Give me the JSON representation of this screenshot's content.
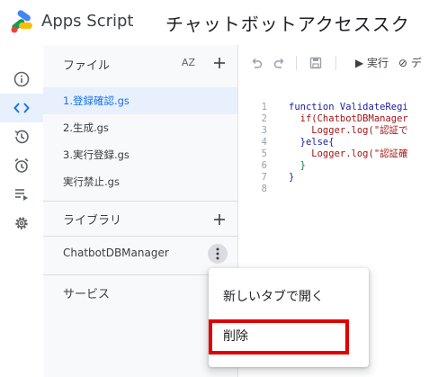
{
  "app": {
    "name": "Apps Script",
    "project_title": "チャットボットアクセススク"
  },
  "rail": {
    "icons": [
      "info-icon",
      "code-icon",
      "history-icon",
      "trigger-alarm-icon",
      "executions-icon",
      "settings-gear-icon"
    ],
    "active_index": 1
  },
  "files_panel": {
    "title": "ファイル",
    "sort_label": "AZ",
    "files": [
      "1.登録確認.gs",
      "2.生成.gs",
      "3.実行登録.gs",
      "実行禁止.gs"
    ],
    "selected_index": 0,
    "libraries_title": "ライブラリ",
    "libraries": [
      "ChatbotDBManager"
    ],
    "services_title": "サービス"
  },
  "editor": {
    "run_label": "▶ 実行",
    "debug_label": "⊘ デ",
    "line_numbers": [
      "1",
      "2",
      "3",
      "4",
      "5",
      "6",
      "7",
      "8"
    ],
    "code_lines": [
      "function ValidateRegi",
      "  if(ChatbotDBManager",
      "    Logger.log(\"認証で",
      "  }else{",
      "    Logger.log(\"認証確",
      "  }",
      "}",
      ""
    ]
  },
  "context_menu": {
    "items": [
      "新しいタブで開く",
      "削除"
    ]
  },
  "colors": {
    "accent": "#1a73e8",
    "selection_bg": "#e8f0fe",
    "highlight_border": "#e00000"
  }
}
